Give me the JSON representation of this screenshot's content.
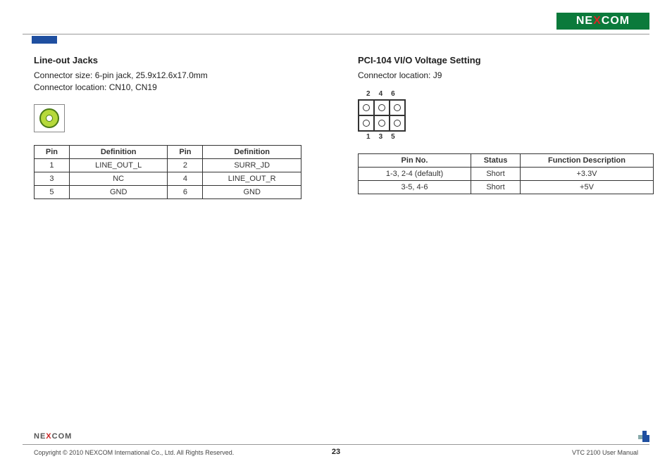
{
  "brand": {
    "left": "NE",
    "x": "X",
    "right": "COM"
  },
  "left": {
    "title": "Line-out Jacks",
    "line1": "Connector size: 6-pin jack, 25.9x12.6x17.0mm",
    "line2": "Connector location: CN10, CN19",
    "table_headers": {
      "pin": "Pin",
      "def": "Definition"
    },
    "rows": [
      {
        "p1": "1",
        "d1": "LINE_OUT_L",
        "p2": "2",
        "d2": "SURR_JD"
      },
      {
        "p1": "3",
        "d1": "NC",
        "p2": "4",
        "d2": "LINE_OUT_R"
      },
      {
        "p1": "5",
        "d1": "GND",
        "p2": "6",
        "d2": "GND"
      }
    ]
  },
  "right": {
    "title": "PCI-104 VI/O Voltage Setting",
    "line1": "Connector location: J9",
    "conn": {
      "top": [
        "2",
        "4",
        "6"
      ],
      "bot": [
        "1",
        "3",
        "5"
      ]
    },
    "table_headers": {
      "pin": "Pin No.",
      "status": "Status",
      "func": "Function Description"
    },
    "rows": [
      {
        "pin": "1-3, 2-4 (default)",
        "status": "Short",
        "func": "+3.3V"
      },
      {
        "pin": "3-5, 4-6",
        "status": "Short",
        "func": "+5V"
      }
    ]
  },
  "footer": {
    "copyright": "Copyright © 2010 NEXCOM International Co., Ltd. All Rights Reserved.",
    "page": "23",
    "doc": "VTC 2100 User Manual"
  }
}
